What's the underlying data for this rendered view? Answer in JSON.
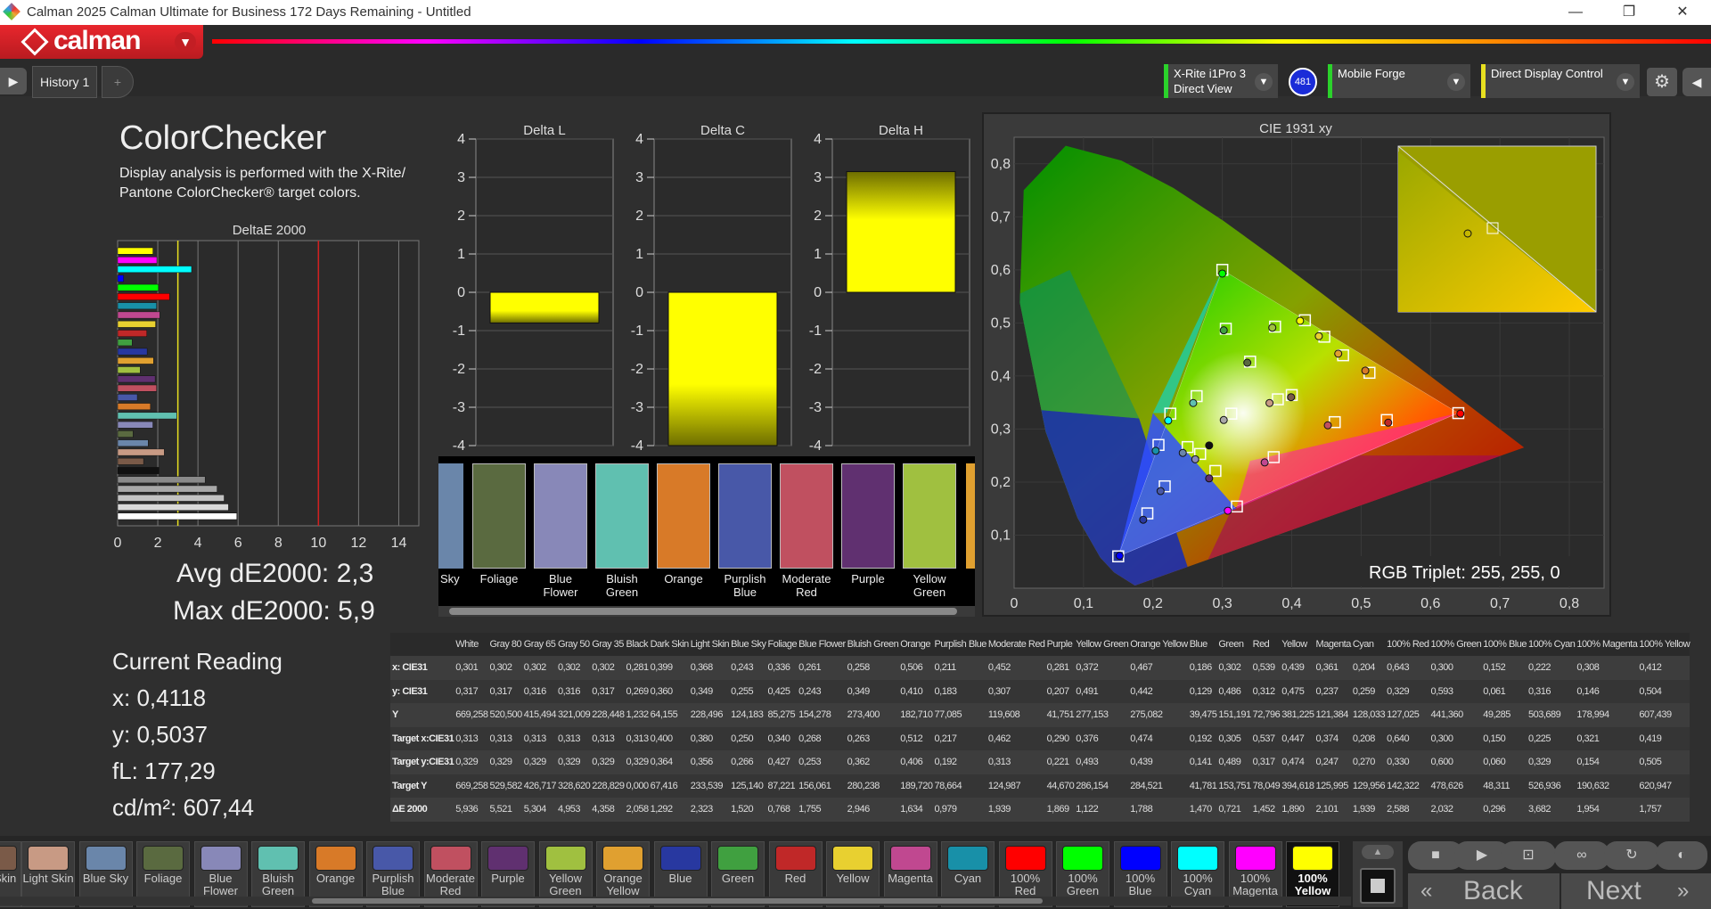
{
  "window": {
    "title": "Calman 2025 Calman Ultimate for Business 172 Days Remaining  - Untitled",
    "controls": [
      "—",
      "❐",
      "✕"
    ]
  },
  "brand": {
    "name": "calman"
  },
  "tabs": [
    {
      "label": "History 1"
    },
    {
      "label": "+"
    }
  ],
  "devices": [
    {
      "line1": "X-Rite i1Pro 3",
      "line2": "Direct View",
      "badge": "481",
      "accent": "#2bd22b"
    },
    {
      "line1": "Mobile Forge",
      "line2": "",
      "accent": "#2bd22b"
    },
    {
      "line1": "Direct Display Control",
      "line2": "",
      "accent": "#e8e020"
    }
  ],
  "page": {
    "title": "ColorChecker",
    "description_1": "Display analysis is performed with the X-Rite/",
    "description_2": "Pantone ColorChecker® target colors.",
    "avg_label": "Avg dE2000: 2,3",
    "max_label": "Max dE2000: 5,9",
    "reading_title": "Current Reading",
    "reading_x": "x: 0,4118",
    "reading_y": "y: 0,5037",
    "reading_fl": "fL: 177,29",
    "reading_cd": "cd/m²: 607,44"
  },
  "chart_data": [
    {
      "type": "bar",
      "orientation": "horizontal",
      "title": "DeltaE 2000",
      "xlim": [
        0,
        15
      ],
      "xticks": [
        "0",
        "2",
        "4",
        "6",
        "8",
        "10",
        "12",
        "14"
      ],
      "thresholds": [
        {
          "value": 3,
          "color": "#e8e020"
        },
        {
          "value": 10,
          "color": "#d02020"
        }
      ],
      "categories": [
        "White",
        "Gray 80",
        "Gray 65",
        "Gray 50",
        "Gray 35",
        "Black",
        "Dark Skin",
        "Light Skin",
        "Blue Sky",
        "Foliage",
        "Blue Flower",
        "Bluish Green",
        "Orange",
        "Purplish Blue",
        "Moderate Red",
        "Purple",
        "Yellow Green",
        "Orange Yellow",
        "Blue",
        "Green",
        "Red",
        "Yellow",
        "Magenta",
        "Cyan",
        "100% Red",
        "100% Green",
        "100% Blue",
        "100% Cyan",
        "100% Magenta",
        "100% Yellow"
      ],
      "values": [
        5.936,
        5.521,
        5.304,
        4.953,
        4.358,
        2.058,
        1.292,
        2.323,
        1.52,
        0.768,
        1.755,
        2.946,
        1.634,
        0.979,
        1.939,
        1.869,
        1.122,
        1.788,
        1.47,
        0.721,
        1.452,
        1.89,
        2.101,
        1.939,
        2.588,
        2.032,
        0.296,
        3.682,
        1.954,
        1.757
      ],
      "colors": [
        "#ffffff",
        "#d9d9d9",
        "#c2c2c2",
        "#a8a8a8",
        "#8a8a8a",
        "#111111",
        "#7a5a48",
        "#c89a84",
        "#6a86aa",
        "#5a6a40",
        "#8888b8",
        "#60c0b0",
        "#d87a28",
        "#4858a8",
        "#c05060",
        "#603070",
        "#a0c040",
        "#e0a030",
        "#2838a0",
        "#40a040",
        "#c02828",
        "#e8d030",
        "#c04890",
        "#1890a8",
        "#ff0000",
        "#00ff00",
        "#0000ff",
        "#00ffff",
        "#ff00ff",
        "#ffff00"
      ]
    },
    {
      "type": "bar",
      "title": "Delta L",
      "ylim": [
        -4,
        4
      ],
      "yticks": [
        "4",
        "3",
        "2",
        "1",
        "0",
        "-1",
        "-2",
        "-3",
        "-4"
      ],
      "values": [
        -0.8
      ]
    },
    {
      "type": "bar",
      "title": "Delta C",
      "ylim": [
        -4,
        4
      ],
      "yticks": [
        "4",
        "3",
        "2",
        "1",
        "0",
        "-1",
        "-2",
        "-3",
        "-4"
      ],
      "values": [
        -4.0
      ]
    },
    {
      "type": "bar",
      "title": "Delta H",
      "ylim": [
        -4,
        4
      ],
      "yticks": [
        "4",
        "3",
        "2",
        "1",
        "0",
        "-1",
        "-2",
        "-3",
        "-4"
      ],
      "values": [
        3.15
      ]
    },
    {
      "type": "scatter",
      "title": "CIE 1931 xy",
      "xlim": [
        0,
        0.85
      ],
      "ylim": [
        0,
        0.85
      ],
      "xticks": [
        "0",
        "0,1",
        "0,2",
        "0,3",
        "0,4",
        "0,5",
        "0,6",
        "0,7",
        "0,8"
      ],
      "yticks": [
        "0,1",
        "0,2",
        "0,3",
        "0,4",
        "0,5",
        "0,6",
        "0,7",
        "0,8"
      ],
      "gamut": [
        [
          0.64,
          0.33
        ],
        [
          0.3,
          0.6
        ],
        [
          0.15,
          0.06
        ]
      ],
      "targets": [
        [
          0.313,
          0.329
        ],
        [
          0.4,
          0.364
        ],
        [
          0.38,
          0.356
        ],
        [
          0.25,
          0.266
        ],
        [
          0.34,
          0.427
        ],
        [
          0.268,
          0.253
        ],
        [
          0.263,
          0.362
        ],
        [
          0.512,
          0.406
        ],
        [
          0.217,
          0.192
        ],
        [
          0.462,
          0.313
        ],
        [
          0.29,
          0.221
        ],
        [
          0.376,
          0.493
        ],
        [
          0.474,
          0.439
        ],
        [
          0.192,
          0.141
        ],
        [
          0.305,
          0.489
        ],
        [
          0.537,
          0.317
        ],
        [
          0.447,
          0.474
        ],
        [
          0.374,
          0.247
        ],
        [
          0.208,
          0.27
        ],
        [
          0.64,
          0.33
        ],
        [
          0.3,
          0.6
        ],
        [
          0.15,
          0.06
        ],
        [
          0.225,
          0.329
        ],
        [
          0.321,
          0.154
        ],
        [
          0.419,
          0.505
        ]
      ],
      "measured": [
        {
          "x": 0.281,
          "y": 0.269,
          "c": "#111111"
        },
        {
          "x": 0.399,
          "y": 0.36,
          "c": "#7a5a48"
        },
        {
          "x": 0.368,
          "y": 0.349,
          "c": "#c89a84"
        },
        {
          "x": 0.243,
          "y": 0.255,
          "c": "#6a86aa"
        },
        {
          "x": 0.336,
          "y": 0.425,
          "c": "#5a6a40"
        },
        {
          "x": 0.261,
          "y": 0.243,
          "c": "#8888b8"
        },
        {
          "x": 0.258,
          "y": 0.349,
          "c": "#60c0b0"
        },
        {
          "x": 0.506,
          "y": 0.41,
          "c": "#d87a28"
        },
        {
          "x": 0.211,
          "y": 0.183,
          "c": "#4858a8"
        },
        {
          "x": 0.452,
          "y": 0.307,
          "c": "#c05060"
        },
        {
          "x": 0.281,
          "y": 0.207,
          "c": "#603070"
        },
        {
          "x": 0.372,
          "y": 0.491,
          "c": "#a0c040"
        },
        {
          "x": 0.467,
          "y": 0.442,
          "c": "#e0a030"
        },
        {
          "x": 0.186,
          "y": 0.129,
          "c": "#2838a0"
        },
        {
          "x": 0.302,
          "y": 0.486,
          "c": "#40a040"
        },
        {
          "x": 0.539,
          "y": 0.312,
          "c": "#c02828"
        },
        {
          "x": 0.439,
          "y": 0.475,
          "c": "#e8d030"
        },
        {
          "x": 0.361,
          "y": 0.237,
          "c": "#c04890"
        },
        {
          "x": 0.204,
          "y": 0.259,
          "c": "#1890a8"
        },
        {
          "x": 0.302,
          "y": 0.317,
          "c": "#a8a8a8"
        },
        {
          "x": 0.643,
          "y": 0.329,
          "c": "#ff0000"
        },
        {
          "x": 0.3,
          "y": 0.593,
          "c": "#00ff00"
        },
        {
          "x": 0.152,
          "y": 0.061,
          "c": "#0000ff"
        },
        {
          "x": 0.222,
          "y": 0.316,
          "c": "#00ffff"
        },
        {
          "x": 0.308,
          "y": 0.146,
          "c": "#ff00ff"
        },
        {
          "x": 0.412,
          "y": 0.504,
          "c": "#ffff00"
        }
      ],
      "rgb_triplet": "RGB Triplet: 255, 255, 0"
    }
  ],
  "swatch_strip": {
    "labels": [
      "Sky",
      "Foliage",
      "Blue Flower",
      "Bluish Green",
      "Orange",
      "Purplish Blue",
      "Moderate Red",
      "Purple",
      "Yellow Green"
    ],
    "colors": [
      "#6a86aa",
      "#5a6a40",
      "#8888b8",
      "#60c0b0",
      "#d87a28",
      "#4858a8",
      "#c05060",
      "#603070",
      "#a0c040"
    ]
  },
  "table": {
    "columns": [
      "",
      "White",
      "Gray 80",
      "Gray 65",
      "Gray 50",
      "Gray 35",
      "Black",
      "Dark Skin",
      "Light Skin",
      "Blue Sky",
      "Foliage",
      "Blue Flower",
      "Bluish Green",
      "Orange",
      "Purplish Blue",
      "Moderate Red",
      "Purple",
      "Yellow Green",
      "Orange Yellow",
      "Blue",
      "Green",
      "Red",
      "Yellow",
      "Magenta",
      "Cyan",
      "100% Red",
      "100% Green",
      "100% Blue",
      "100% Cyan",
      "100% Magenta",
      "100% Yellow"
    ],
    "rows": [
      [
        "x: CIE31",
        "0,301",
        "0,302",
        "0,302",
        "0,302",
        "0,302",
        "0,281",
        "0,399",
        "0,368",
        "0,243",
        "0,336",
        "0,261",
        "0,258",
        "0,506",
        "0,211",
        "0,452",
        "0,281",
        "0,372",
        "0,467",
        "0,186",
        "0,302",
        "0,539",
        "0,439",
        "0,361",
        "0,204",
        "0,643",
        "0,300",
        "0,152",
        "0,222",
        "0,308",
        "0,412"
      ],
      [
        "y: CIE31",
        "0,317",
        "0,317",
        "0,316",
        "0,316",
        "0,317",
        "0,269",
        "0,360",
        "0,349",
        "0,255",
        "0,425",
        "0,243",
        "0,349",
        "0,410",
        "0,183",
        "0,307",
        "0,207",
        "0,491",
        "0,442",
        "0,129",
        "0,486",
        "0,312",
        "0,475",
        "0,237",
        "0,259",
        "0,329",
        "0,593",
        "0,061",
        "0,316",
        "0,146",
        "0,504"
      ],
      [
        "Y",
        "669,258",
        "520,500",
        "415,494",
        "321,009",
        "228,448",
        "1,232",
        "64,155",
        "228,496",
        "124,183",
        "85,275",
        "154,278",
        "273,400",
        "182,710",
        "77,085",
        "119,608",
        "41,751",
        "277,153",
        "275,082",
        "39,475",
        "151,191",
        "72,796",
        "381,225",
        "121,384",
        "128,033",
        "127,025",
        "441,360",
        "49,285",
        "503,689",
        "178,994",
        "607,439"
      ],
      [
        "Target x:CIE31",
        "0,313",
        "0,313",
        "0,313",
        "0,313",
        "0,313",
        "0,313",
        "0,400",
        "0,380",
        "0,250",
        "0,340",
        "0,268",
        "0,263",
        "0,512",
        "0,217",
        "0,462",
        "0,290",
        "0,376",
        "0,474",
        "0,192",
        "0,305",
        "0,537",
        "0,447",
        "0,374",
        "0,208",
        "0,640",
        "0,300",
        "0,150",
        "0,225",
        "0,321",
        "0,419"
      ],
      [
        "Target y:CIE31",
        "0,329",
        "0,329",
        "0,329",
        "0,329",
        "0,329",
        "0,329",
        "0,364",
        "0,356",
        "0,266",
        "0,427",
        "0,253",
        "0,362",
        "0,406",
        "0,192",
        "0,313",
        "0,221",
        "0,493",
        "0,439",
        "0,141",
        "0,489",
        "0,317",
        "0,474",
        "0,247",
        "0,270",
        "0,330",
        "0,600",
        "0,060",
        "0,329",
        "0,154",
        "0,505"
      ],
      [
        "Target Y",
        "669,258",
        "529,582",
        "426,717",
        "328,620",
        "228,829",
        "0,000",
        "67,416",
        "233,539",
        "125,140",
        "87,221",
        "156,061",
        "280,238",
        "189,720",
        "78,664",
        "124,987",
        "44,670",
        "286,154",
        "284,521",
        "41,781",
        "153,751",
        "78,049",
        "394,618",
        "125,995",
        "129,956",
        "142,322",
        "478,626",
        "48,311",
        "526,936",
        "190,632",
        "620,947"
      ],
      [
        "ΔE 2000",
        "5,936",
        "5,521",
        "5,304",
        "4,953",
        "4,358",
        "2,058",
        "1,292",
        "2,323",
        "1,520",
        "0,768",
        "1,755",
        "2,946",
        "1,634",
        "0,979",
        "1,939",
        "1,869",
        "1,122",
        "1,788",
        "1,470",
        "0,721",
        "1,452",
        "1,890",
        "2,101",
        "1,939",
        "2,588",
        "2,032",
        "0,296",
        "3,682",
        "1,954",
        "1,757"
      ]
    ]
  },
  "bottom_swatches": [
    {
      "label": "Skin",
      "color": "#7a5a48"
    },
    {
      "label": "Light Skin",
      "color": "#c89a84"
    },
    {
      "label": "Blue Sky",
      "color": "#6a86aa"
    },
    {
      "label": "Foliage",
      "color": "#5a6a40"
    },
    {
      "label": "Blue Flower",
      "color": "#8888b8"
    },
    {
      "label": "Bluish Green",
      "color": "#60c0b0"
    },
    {
      "label": "Orange",
      "color": "#d87a28"
    },
    {
      "label": "Purplish Blue",
      "color": "#4858a8"
    },
    {
      "label": "Moderate Red",
      "color": "#c05060"
    },
    {
      "label": "Purple",
      "color": "#603070"
    },
    {
      "label": "Yellow Green",
      "color": "#a0c040"
    },
    {
      "label": "Orange Yellow",
      "color": "#e0a030"
    },
    {
      "label": "Blue",
      "color": "#2838a0"
    },
    {
      "label": "Green",
      "color": "#40a040"
    },
    {
      "label": "Red",
      "color": "#c02828"
    },
    {
      "label": "Yellow",
      "color": "#e8d030"
    },
    {
      "label": "Magenta",
      "color": "#c04890"
    },
    {
      "label": "Cyan",
      "color": "#1890a8"
    },
    {
      "label": "100% Red",
      "color": "#ff0000"
    },
    {
      "label": "100% Green",
      "color": "#00ff00"
    },
    {
      "label": "100% Blue",
      "color": "#0000ff"
    },
    {
      "label": "100% Cyan",
      "color": "#00ffff"
    },
    {
      "label": "100% Magenta",
      "color": "#ff00ff"
    },
    {
      "label": "100% Yellow",
      "color": "#ffff00",
      "selected": true
    }
  ],
  "nav": {
    "back": "Back",
    "next": "Next"
  }
}
